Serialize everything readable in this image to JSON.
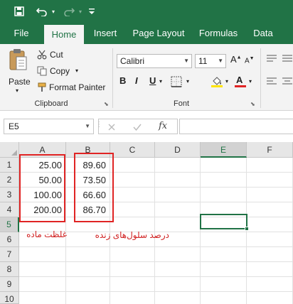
{
  "title_bar": {
    "save_icon": "save-icon",
    "undo_icon": "undo-icon",
    "redo_icon": "redo-icon",
    "customize_icon": "customize-icon"
  },
  "tabs": [
    {
      "label": "File"
    },
    {
      "label": "Home"
    },
    {
      "label": "Insert"
    },
    {
      "label": "Page Layout"
    },
    {
      "label": "Formulas"
    },
    {
      "label": "Data"
    }
  ],
  "ribbon": {
    "paste_label": "Paste",
    "cut_label": "Cut",
    "copy_label": "Copy",
    "format_painter_label": "Format Painter",
    "clipboard_label": "Clipboard",
    "font_name": "Calibri",
    "font_size": "11",
    "bold": "B",
    "italic": "I",
    "underline": "U",
    "font_color_glyph": "A",
    "font_group_label": "Font",
    "accent_color": "#217346",
    "font_color": "#e02424",
    "fill_color": "#ffe400"
  },
  "formula_bar": {
    "name_box": "E5",
    "fx_label": "fx",
    "formula": ""
  },
  "sheet": {
    "columns": [
      "A",
      "B",
      "C",
      "D",
      "E",
      "F"
    ],
    "rows": [
      "1",
      "2",
      "3",
      "4",
      "5",
      "6",
      "7",
      "8",
      "9",
      "10"
    ],
    "selected_column": "E",
    "selected_row": "5",
    "col_a_values": [
      "25.00",
      "50.00",
      "100.00",
      "200.00"
    ],
    "col_b_values": [
      "89.60",
      "73.50",
      "66.60",
      "86.70"
    ],
    "annotation_a": "غلظت ماده",
    "annotation_b": "درصد سلول‌های زنده",
    "annotation_color": "#e02424"
  }
}
